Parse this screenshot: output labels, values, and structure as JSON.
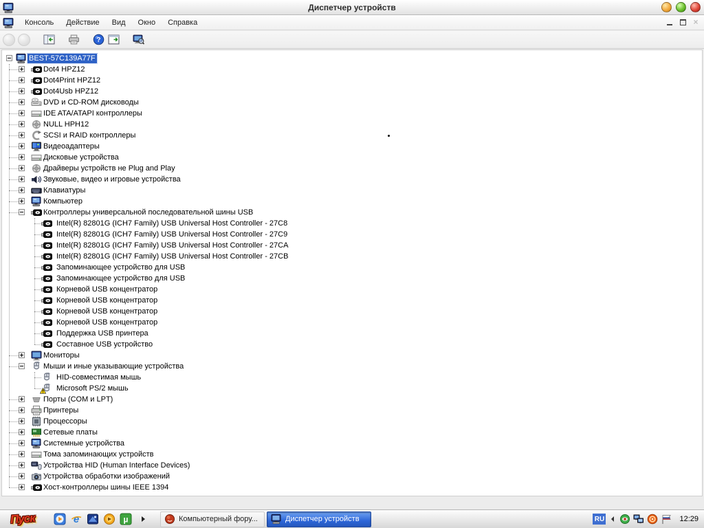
{
  "window": {
    "title": "Диспетчер устройств",
    "title_icon": "device-manager-icon",
    "controls": {
      "minimize": "minimize-button",
      "maximize": "maximize-button",
      "close": "close-button"
    }
  },
  "menu": {
    "icon": "device-manager-icon",
    "items": [
      {
        "label": "Консоль"
      },
      {
        "label": "Действие"
      },
      {
        "label": "Вид"
      },
      {
        "label": "Окно"
      },
      {
        "label": "Справка"
      }
    ],
    "child_controls": [
      "minimize",
      "restore",
      "close"
    ]
  },
  "toolbar": {
    "buttons": [
      {
        "name": "back-button",
        "icon": "nav-circle",
        "disabled": true
      },
      {
        "name": "forward-button",
        "icon": "nav-circle",
        "disabled": true
      },
      {
        "name": "show-hide-console-tree-button",
        "icon": "panel-left-icon"
      },
      {
        "name": "print-button",
        "icon": "printer-icon"
      },
      {
        "name": "help-button",
        "icon": "help-globe-icon"
      },
      {
        "name": "show-hide-action-pane-button",
        "icon": "panel-right-icon"
      },
      {
        "name": "scan-hardware-changes-button",
        "icon": "computer-search-icon"
      }
    ]
  },
  "tree": {
    "items": [
      {
        "label": "BEST-57C139A77F",
        "icon": "computer",
        "expand": "minus",
        "level": 0,
        "selected": true
      },
      {
        "label": "Dot4 HPZ12",
        "icon": "usb-card",
        "expand": "plus",
        "level": 1
      },
      {
        "label": "Dot4Print HPZ12",
        "icon": "usb-card",
        "expand": "plus",
        "level": 1
      },
      {
        "label": "Dot4Usb HPZ12",
        "icon": "usb-card",
        "expand": "plus",
        "level": 1
      },
      {
        "label": "DVD и CD-ROM дисководы",
        "icon": "cd-drive",
        "expand": "plus",
        "level": 1
      },
      {
        "label": "IDE ATA/ATAPI контроллеры",
        "icon": "drive-gray",
        "expand": "plus",
        "level": 1
      },
      {
        "label": "NULL HPH12",
        "icon": "non-pnp",
        "expand": "plus",
        "level": 1
      },
      {
        "label": "SCSI и RAID контроллеры",
        "icon": "scsi",
        "expand": "plus",
        "level": 1
      },
      {
        "label": "Видеоадаптеры",
        "icon": "display-adapter",
        "expand": "plus",
        "level": 1
      },
      {
        "label": "Дисковые устройства",
        "icon": "drive-gray",
        "expand": "plus",
        "level": 1
      },
      {
        "label": "Драйверы устройств не Plug and Play",
        "icon": "non-pnp",
        "expand": "plus",
        "level": 1
      },
      {
        "label": "Звуковые, видео и игровые устройства",
        "icon": "sound",
        "expand": "plus",
        "level": 1
      },
      {
        "label": "Клавиатуры",
        "icon": "keyboard",
        "expand": "plus",
        "level": 1
      },
      {
        "label": "Компьютер",
        "icon": "computer",
        "expand": "plus",
        "level": 1
      },
      {
        "label": "Контроллеры универсальной последовательной шины USB",
        "icon": "usb-card",
        "expand": "minus",
        "level": 1
      },
      {
        "label": "Intel(R) 82801G (ICH7 Family) USB Universal Host Controller - 27C8",
        "icon": "usb-card",
        "level": 2
      },
      {
        "label": "Intel(R) 82801G (ICH7 Family) USB Universal Host Controller - 27C9",
        "icon": "usb-card",
        "level": 2
      },
      {
        "label": "Intel(R) 82801G (ICH7 Family) USB Universal Host Controller - 27CA",
        "icon": "usb-card",
        "level": 2
      },
      {
        "label": "Intel(R) 82801G (ICH7 Family) USB Universal Host Controller - 27CB",
        "icon": "usb-card",
        "level": 2
      },
      {
        "label": "Запоминающее устройство для USB",
        "icon": "usb-card",
        "level": 2
      },
      {
        "label": "Запоминающее устройство для USB",
        "icon": "usb-card",
        "level": 2
      },
      {
        "label": "Корневой USB концентратор",
        "icon": "usb-card",
        "level": 2
      },
      {
        "label": "Корневой USB концентратор",
        "icon": "usb-card",
        "level": 2
      },
      {
        "label": "Корневой USB концентратор",
        "icon": "usb-card",
        "level": 2
      },
      {
        "label": "Корневой USB концентратор",
        "icon": "usb-card",
        "level": 2
      },
      {
        "label": "Поддержка USB принтера",
        "icon": "usb-card",
        "level": 2
      },
      {
        "label": "Составное USB устройство",
        "icon": "usb-card",
        "level": 2
      },
      {
        "label": "Мониторы",
        "icon": "monitor",
        "expand": "plus",
        "level": 1
      },
      {
        "label": "Мыши и иные указывающие устройства",
        "icon": "mouse",
        "expand": "minus",
        "level": 1
      },
      {
        "label": "HID-совместимая мышь",
        "icon": "mouse",
        "level": 2
      },
      {
        "label": "Microsoft PS/2 мышь",
        "icon": "mouse",
        "warning": true,
        "level": 2
      },
      {
        "label": "Порты (COM и LPT)",
        "icon": "ports",
        "expand": "plus",
        "level": 1
      },
      {
        "label": "Принтеры",
        "icon": "printer",
        "expand": "plus",
        "level": 1
      },
      {
        "label": "Процессоры",
        "icon": "cpu",
        "expand": "plus",
        "level": 1
      },
      {
        "label": "Сетевые платы",
        "icon": "network",
        "expand": "plus",
        "level": 1
      },
      {
        "label": "Системные устройства",
        "icon": "computer",
        "expand": "plus",
        "level": 1
      },
      {
        "label": "Тома запоминающих устройств",
        "icon": "drive-gray",
        "expand": "plus",
        "level": 1
      },
      {
        "label": "Устройства HID (Human Interface Devices)",
        "icon": "hid",
        "expand": "plus",
        "level": 1
      },
      {
        "label": "Устройства обработки изображений",
        "icon": "imaging",
        "expand": "plus",
        "level": 1
      },
      {
        "label": "Хост-контроллеры шины IEEE 1394",
        "icon": "usb-card",
        "expand": "plus",
        "level": 1
      }
    ]
  },
  "taskbar": {
    "start_label": "Пуск",
    "quick_launch": [
      {
        "name": "media-player-icon",
        "icon": "wmp"
      },
      {
        "name": "internet-explorer-icon",
        "icon": "ie"
      },
      {
        "name": "file-manager-icon",
        "icon": "fileman"
      },
      {
        "name": "orange-app-icon",
        "icon": "orange-app"
      },
      {
        "name": "utorrent-icon",
        "icon": "utorrent"
      }
    ],
    "buttons": [
      {
        "label": "Компьютерный фору...",
        "icon": "forum-sphere",
        "active": false,
        "name": "task-button-forum"
      },
      {
        "label": "Диспетчер устройств",
        "icon": "dm-small",
        "active": true,
        "name": "task-button-device-manager"
      }
    ],
    "tray": {
      "language": "RU",
      "icons": [
        {
          "name": "antivirus-tray-icon",
          "icon": "tray-av"
        },
        {
          "name": "network-tray-icon",
          "icon": "tray-net"
        },
        {
          "name": "downloader-tray-icon",
          "icon": "tray-orange"
        },
        {
          "name": "flag-tray-icon",
          "icon": "tray-flag"
        }
      ],
      "clock": "12:29"
    }
  }
}
